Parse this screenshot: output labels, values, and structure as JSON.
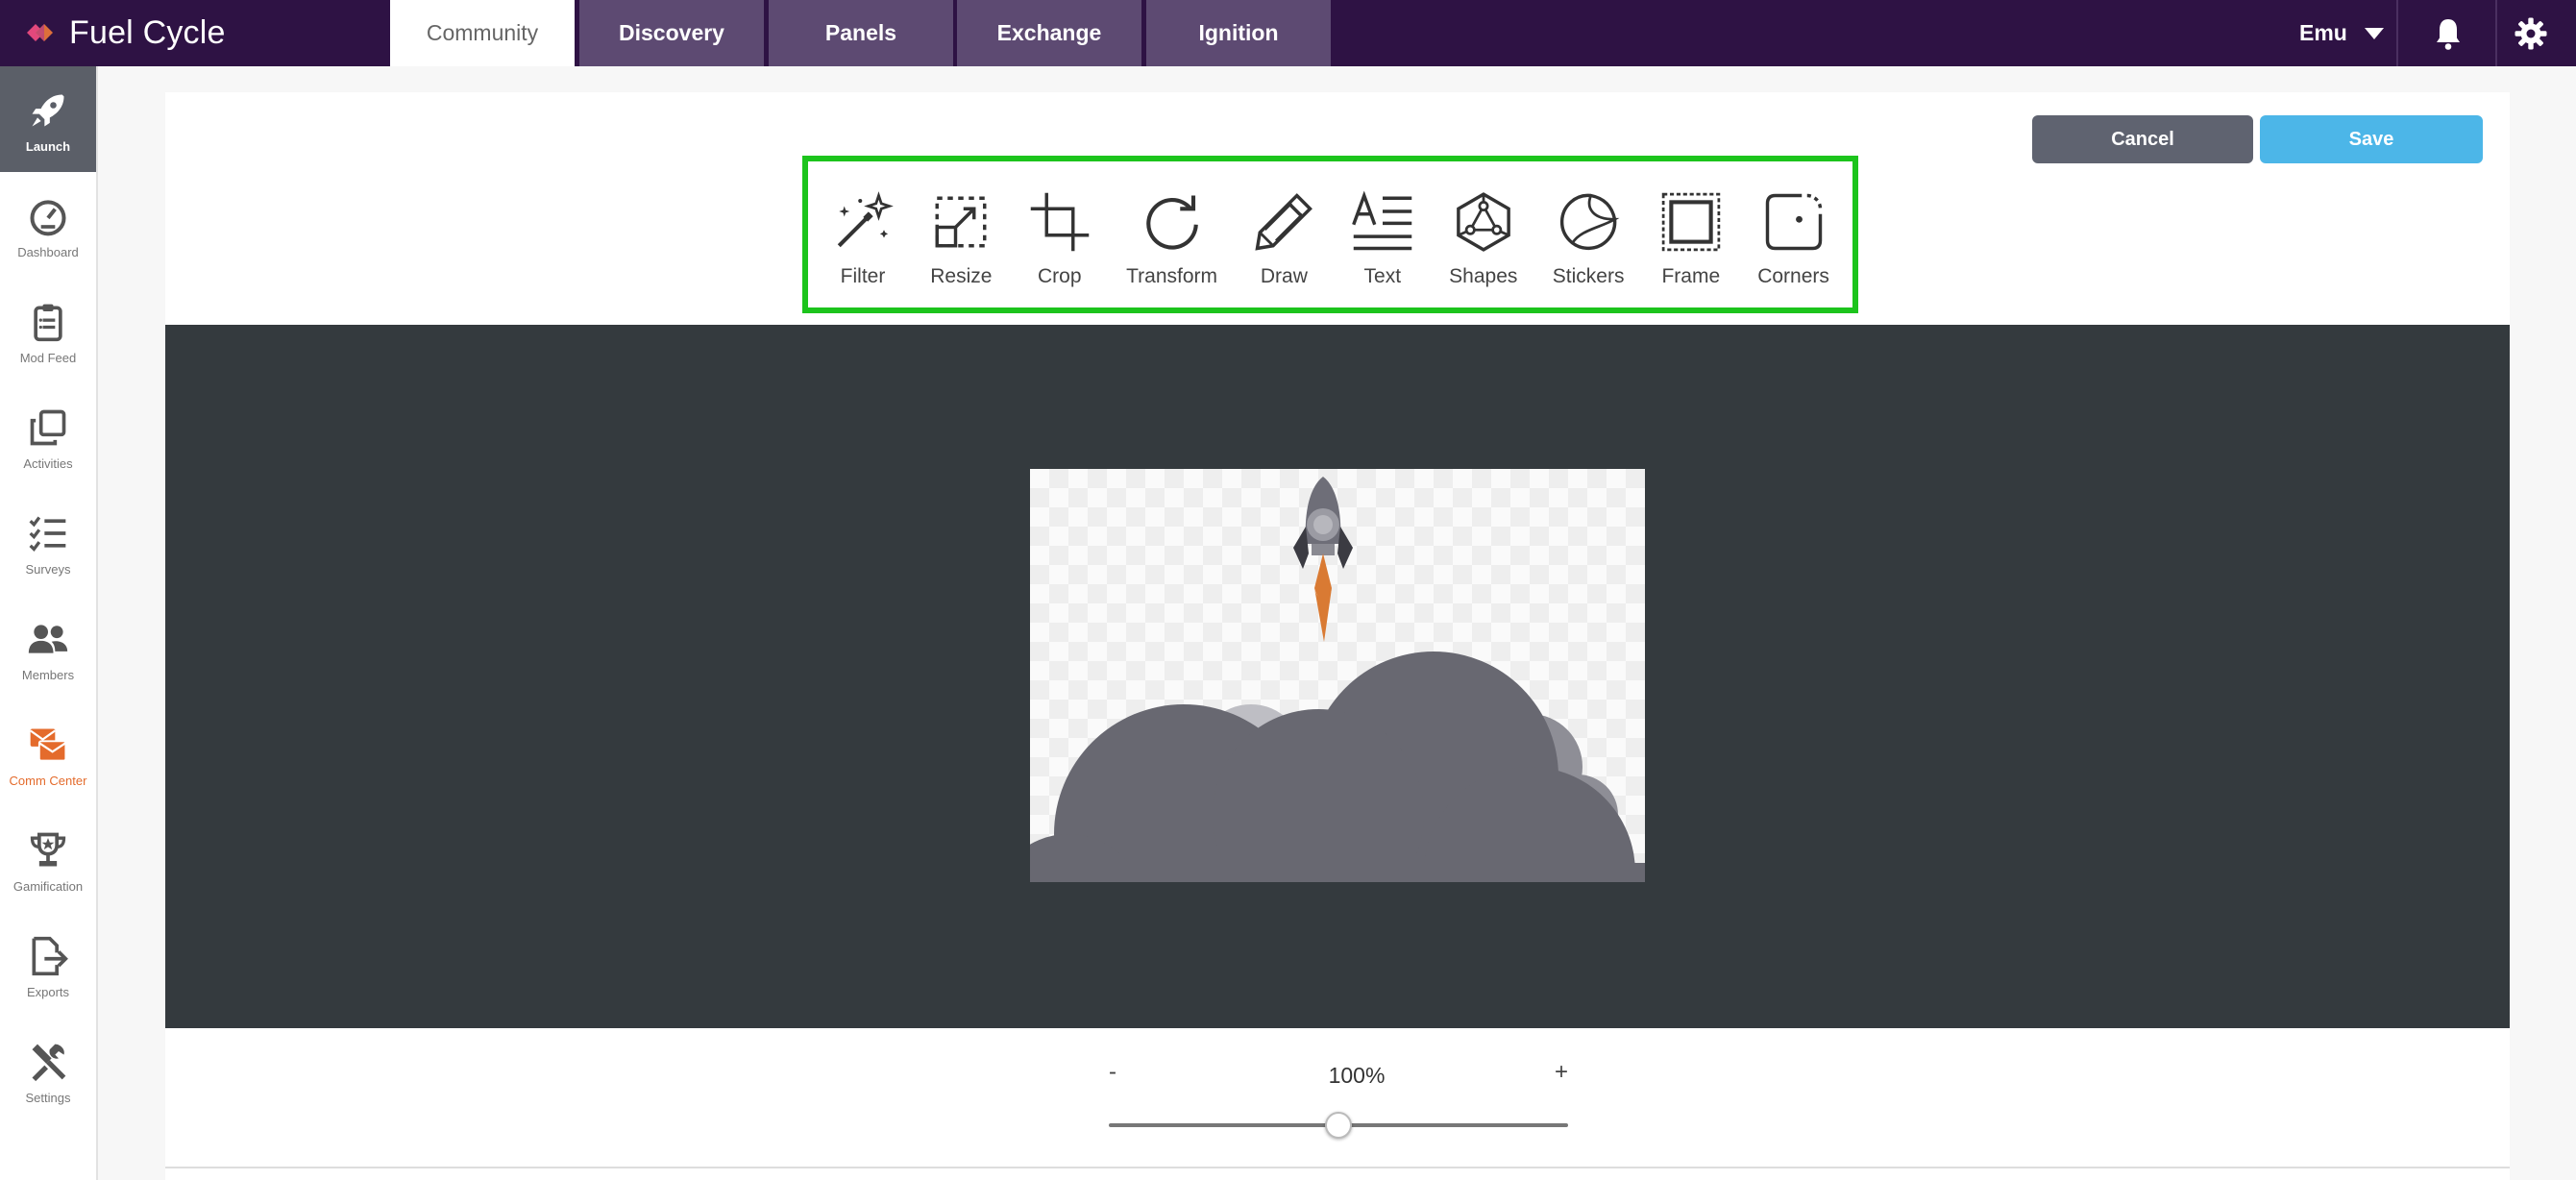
{
  "brand": {
    "name": "Fuel Cycle"
  },
  "top_tabs": [
    {
      "label": "Community",
      "active": true
    },
    {
      "label": "Discovery",
      "active": false
    },
    {
      "label": "Panels",
      "active": false
    },
    {
      "label": "Exchange",
      "active": false
    },
    {
      "label": "Ignition",
      "active": false
    }
  ],
  "user": {
    "name": "Emu",
    "icons": [
      "chevron-down-icon",
      "bell-icon",
      "gear-icon"
    ]
  },
  "sidebar": {
    "items": [
      {
        "label": "Launch",
        "icon": "rocket-icon",
        "active": true
      },
      {
        "label": "Dashboard",
        "icon": "gauge-icon"
      },
      {
        "label": "Mod Feed",
        "icon": "clipboard-icon"
      },
      {
        "label": "Activities",
        "icon": "copy-icon"
      },
      {
        "label": "Surveys",
        "icon": "checklist-icon"
      },
      {
        "label": "Members",
        "icon": "people-icon"
      },
      {
        "label": "Comm Center",
        "icon": "envelopes-icon",
        "highlight": true
      },
      {
        "label": "Gamification",
        "icon": "trophy-icon"
      },
      {
        "label": "Exports",
        "icon": "export-icon"
      },
      {
        "label": "Settings",
        "icon": "tools-icon"
      }
    ]
  },
  "actions": {
    "cancel_label": "Cancel",
    "save_label": "Save"
  },
  "toolbar": {
    "tools": [
      {
        "label": "Filter",
        "icon": "magic-wand-icon"
      },
      {
        "label": "Resize",
        "icon": "resize-icon"
      },
      {
        "label": "Crop",
        "icon": "crop-icon"
      },
      {
        "label": "Transform",
        "icon": "rotate-icon"
      },
      {
        "label": "Draw",
        "icon": "pencil-icon"
      },
      {
        "label": "Text",
        "icon": "text-icon"
      },
      {
        "label": "Shapes",
        "icon": "shapes-icon"
      },
      {
        "label": "Stickers",
        "icon": "sticker-icon"
      },
      {
        "label": "Frame",
        "icon": "frame-icon"
      },
      {
        "label": "Corners",
        "icon": "corners-icon"
      }
    ],
    "highlight_color": "#1cc41c"
  },
  "canvas": {
    "image": "rocket-launch-illustration",
    "background_color": "#343a3e"
  },
  "zoom": {
    "minus_label": "-",
    "plus_label": "+",
    "value_label": "100%",
    "slider_fraction": 0.5
  },
  "colors": {
    "topbar": "#2e1244",
    "accent": "#4cb6e8",
    "comm_center": "#e46b2c",
    "cancel": "#5f6370"
  }
}
